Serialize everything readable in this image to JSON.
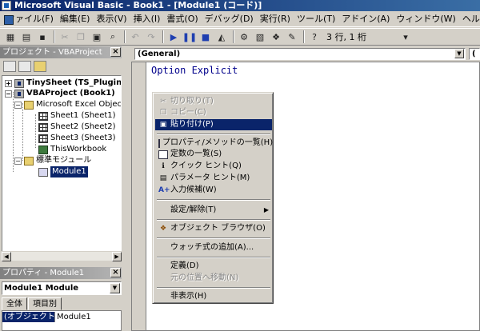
{
  "window": {
    "title": "Microsoft Visual Basic - Book1 - [Module1 (コード)]"
  },
  "menu": {
    "items": [
      "ファイル(F)",
      "編集(E)",
      "表示(V)",
      "挿入(I)",
      "書式(O)",
      "デバッグ(D)",
      "実行(R)",
      "ツール(T)",
      "アドイン(A)",
      "ウィンドウ(W)",
      "ヘルプ(H)"
    ]
  },
  "toolbar": {
    "cursor_position": "3 行, 1 桁"
  },
  "project_panel": {
    "title": "プロジェクト - VBAProject",
    "tree": {
      "tinysheet": "TinySheet (TS_Plugin.x",
      "vbaproject": "VBAProject (Book1)",
      "excel_objects": "Microsoft Excel Object",
      "sheet1": "Sheet1 (Sheet1)",
      "sheet2": "Sheet2 (Sheet2)",
      "sheet3": "Sheet3 (Sheet3)",
      "thisworkbook": "ThisWorkbook",
      "standard_modules": "標準モジュール",
      "module1": "Module1"
    }
  },
  "properties_panel": {
    "title": "プロパティ - Module1",
    "object_combo": "Module1  Module",
    "tabs": [
      "全体",
      "項目別"
    ],
    "row": {
      "name": "(オブジェクト名)",
      "value": "Module1"
    }
  },
  "code_window": {
    "object_combo": "(General)",
    "proc_combo": "(",
    "code_line": "Option Explicit"
  },
  "context_menu": {
    "cut": "切り取り(T)",
    "copy": "コピー(C)",
    "paste": "貼り付け(P)",
    "properties_methods": "プロパティ/メソッドの一覧(H)",
    "constants": "定数の一覧(S)",
    "quick_info": "クイック ヒント(Q)",
    "parameter_info": "パラメータ ヒント(M)",
    "complete_word": "入力候補(W)",
    "toggle": "設定/解除(T)",
    "object_browser": "オブジェクト ブラウザ(O)",
    "add_watch": "ウォッチ式の追加(A)...",
    "definition": "定義(D)",
    "last_position": "元の位置へ移動(N)",
    "hide": "非表示(H)"
  }
}
